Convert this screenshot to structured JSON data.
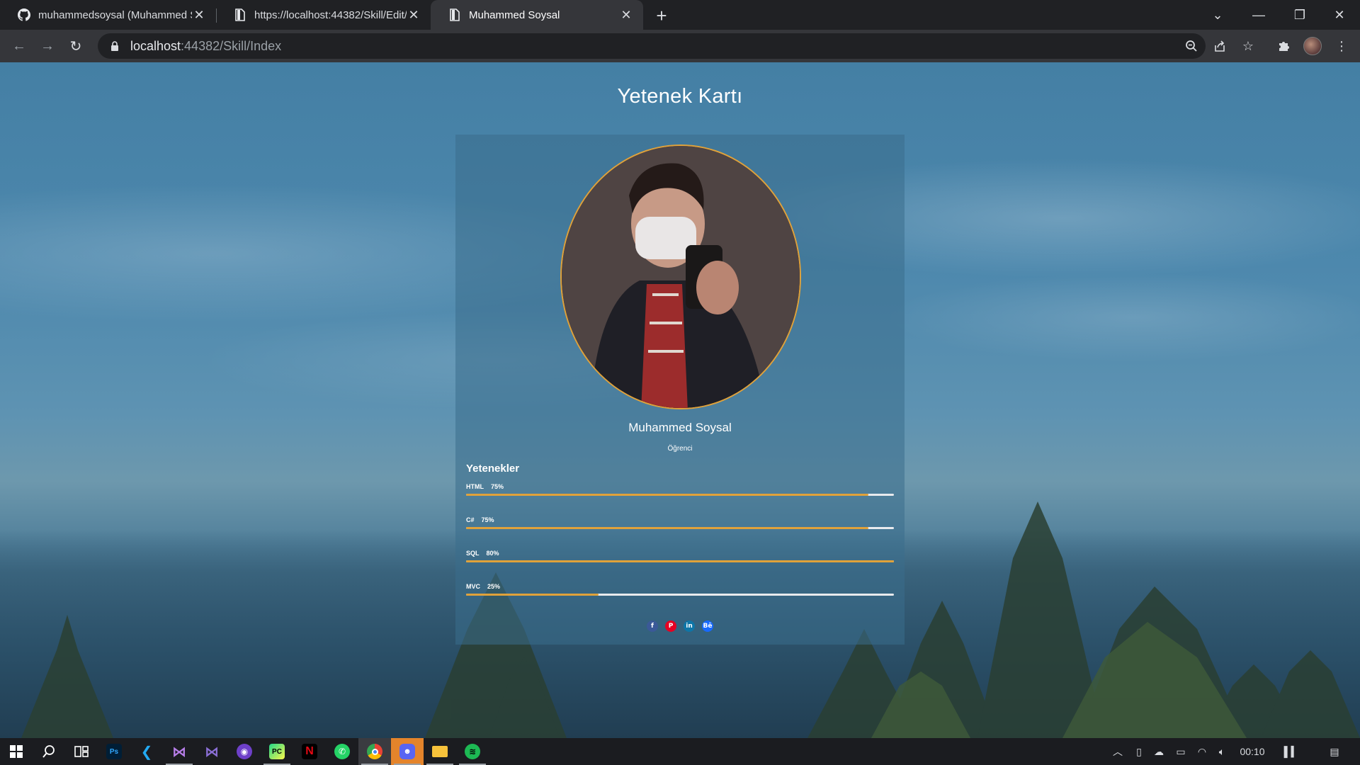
{
  "browser": {
    "tabs": [
      {
        "title": "muhammedsoysal (Muhammed S",
        "icon": "github-icon"
      },
      {
        "title": "https://localhost:44382/Skill/Edit/",
        "icon": "page-icon"
      },
      {
        "title": "Muhammed Soysal",
        "icon": "page-icon",
        "active": true
      }
    ],
    "url_host": "localhost",
    "url_path": ":44382/Skill/Index"
  },
  "page": {
    "title": "Yetenek Kartı",
    "profile": {
      "name": "Muhammed Soysal",
      "role": "Öğrenci"
    },
    "skills_heading": "Yetenekler",
    "skills": [
      {
        "name": "HTML",
        "percent_label": "75%",
        "fraction": 0.94
      },
      {
        "name": "C#",
        "percent_label": "75%",
        "fraction": 0.94
      },
      {
        "name": "SQL",
        "percent_label": "80%",
        "fraction": 1.0
      },
      {
        "name": "MVC",
        "percent_label": "25%",
        "fraction": 0.31
      }
    ],
    "socials": [
      {
        "icon": "facebook-icon",
        "glyph": "f",
        "color": "#3b5998"
      },
      {
        "icon": "pinterest-icon",
        "glyph": "P",
        "color": "#e60023"
      },
      {
        "icon": "linkedin-icon",
        "glyph": "in",
        "color": "#0e76a8"
      },
      {
        "icon": "behance-icon",
        "glyph": "Bē",
        "color": "#1769ff"
      }
    ]
  },
  "taskbar": {
    "clock": "00:10",
    "apps": [
      "windows-start-icon",
      "search-icon",
      "task-view-icon",
      "photoshop-icon",
      "vscode-icon",
      "visual-studio-icon",
      "visual-studio-preview-icon",
      "github-desktop-icon",
      "pycharm-icon",
      "netflix-icon",
      "whatsapp-icon",
      "chrome-icon",
      "discord-icon",
      "file-explorer-icon",
      "spotify-icon"
    ]
  },
  "colors": {
    "accent": "#e0a23a",
    "card_bg": "rgba(58,110,140,0.55)",
    "track": "#e8eaed"
  }
}
